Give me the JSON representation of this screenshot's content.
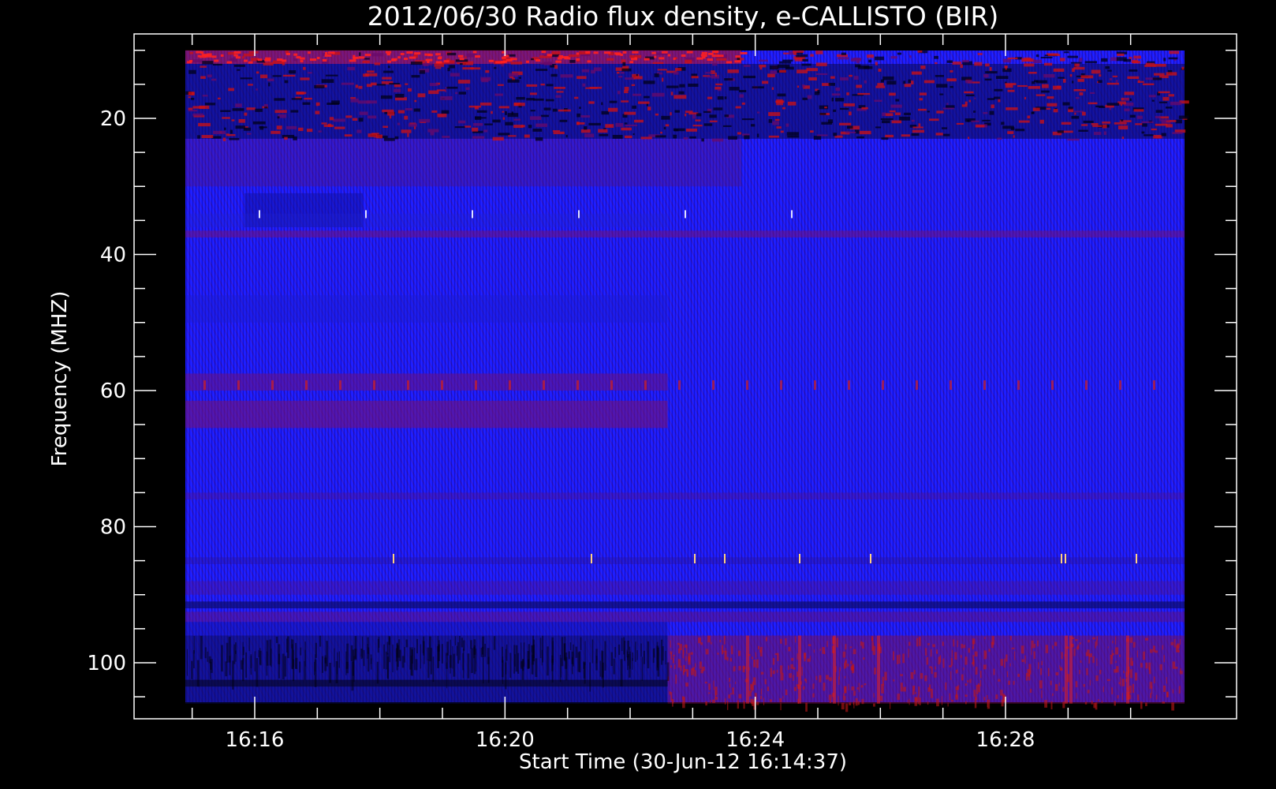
{
  "chart_data": {
    "type": "heatmap",
    "title": "2012/06/30  Radio flux density, e-CALLISTO (BIR)",
    "xlabel": "Start Time (30-Jun-12 16:14:37)",
    "ylabel": "Frequency (MHZ)",
    "x_ticks": [
      "16:16",
      "16:20",
      "16:24",
      "16:28"
    ],
    "x_tick_minutes": [
      16,
      20,
      24,
      28
    ],
    "x_range_minutes": [
      14.62,
      30.0
    ],
    "y_ticks": [
      20,
      40,
      60,
      80,
      100
    ],
    "y_range": [
      10,
      106
    ],
    "colors": {
      "background": "#000000",
      "low": "#0a0a3a",
      "mid": "#1a1aff",
      "high": "#b01010",
      "peak": "#ffd080"
    }
  }
}
